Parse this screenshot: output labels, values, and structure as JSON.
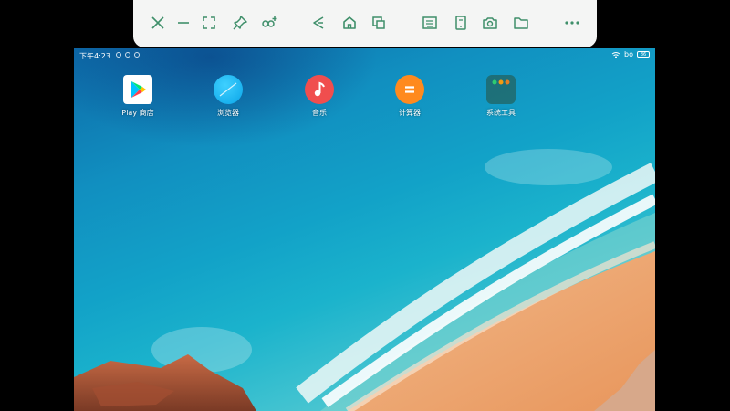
{
  "toolbar": {
    "buttons": [
      {
        "name": "close-icon"
      },
      {
        "name": "minimize-icon"
      },
      {
        "name": "fullscreen-icon"
      },
      {
        "name": "pin-icon"
      },
      {
        "name": "link-add-icon"
      },
      {
        "name": "back-icon"
      },
      {
        "name": "home-icon"
      },
      {
        "name": "recent-apps-icon"
      },
      {
        "name": "keyboard-icon"
      },
      {
        "name": "phone-icon"
      },
      {
        "name": "screenshot-camera-icon"
      },
      {
        "name": "folder-icon"
      },
      {
        "name": "more-icon"
      }
    ],
    "icon_color": "#3f8f6a"
  },
  "statusbar": {
    "time": "下午4:23",
    "right_text": "bo",
    "battery": "86"
  },
  "apps": [
    {
      "label": "Play 商店",
      "icon": "play-store-icon"
    },
    {
      "label": "浏览器",
      "icon": "browser-icon"
    },
    {
      "label": "音乐",
      "icon": "music-icon"
    },
    {
      "label": "计算器",
      "icon": "calculator-icon"
    },
    {
      "label": "系统工具",
      "icon": "system-tools-folder-icon"
    }
  ]
}
